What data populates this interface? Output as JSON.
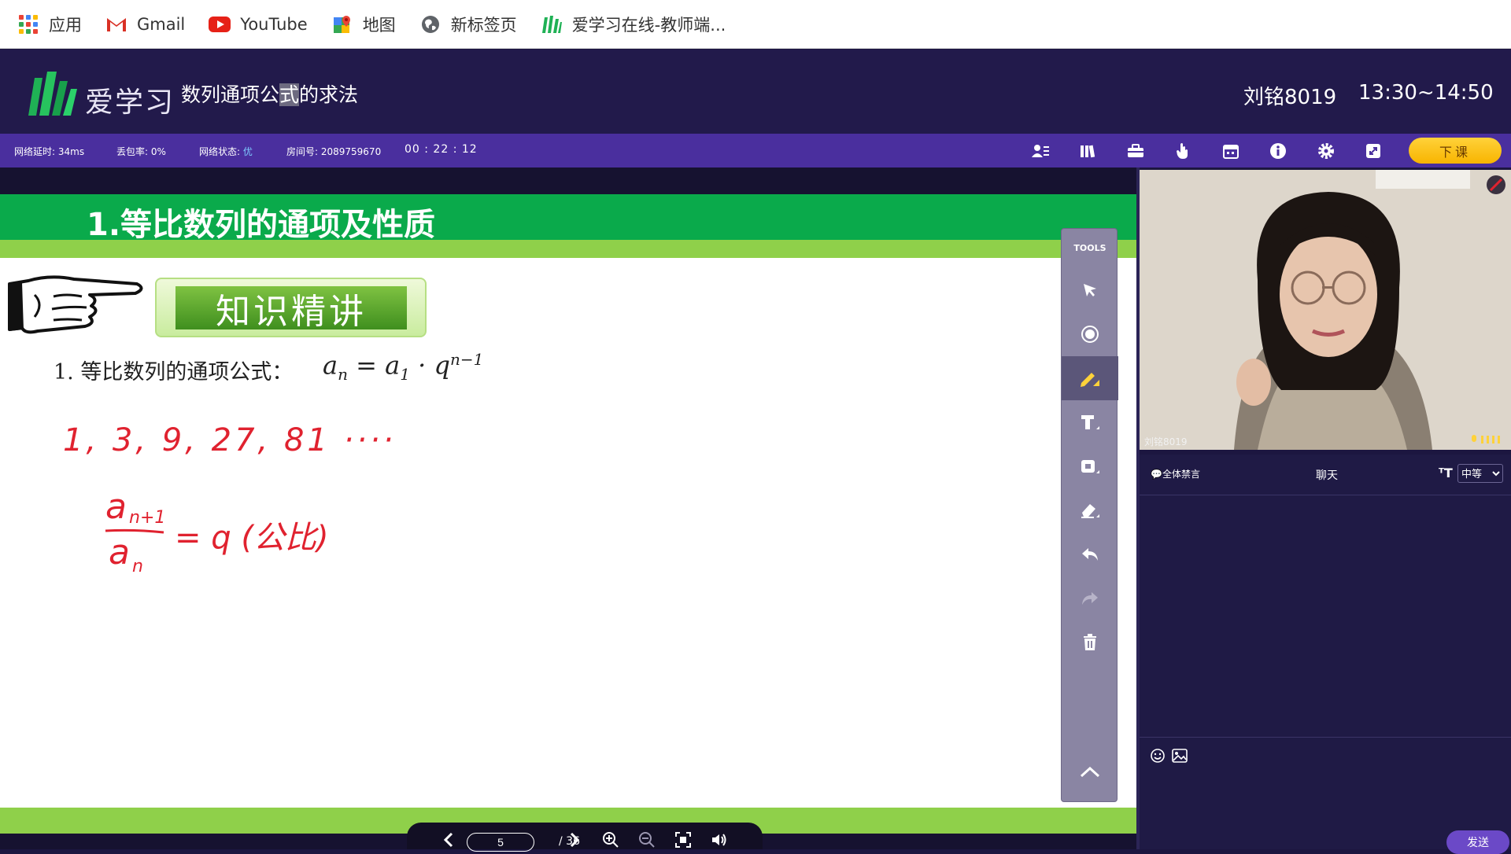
{
  "bookmarks": [
    {
      "label": "应用",
      "icon": "apps-grid-icon"
    },
    {
      "label": "Gmail",
      "icon": "gmail-icon"
    },
    {
      "label": "YouTube",
      "icon": "youtube-icon"
    },
    {
      "label": "地图",
      "icon": "maps-icon"
    },
    {
      "label": "新标签页",
      "icon": "globe-icon"
    },
    {
      "label": "爱学习在线-教师端...",
      "icon": "aixuexi-icon"
    }
  ],
  "header": {
    "logo_text": "爱学习",
    "course_title_a": "数列通项公",
    "course_title_hl": "式",
    "course_title_b": "的求法",
    "teacher": "刘铭8019",
    "time_range": "13:30~14:50"
  },
  "status": {
    "latency": "网络延时: 34ms",
    "loss": "丢包率: 0%",
    "net_label": "网络状态: ",
    "net_value": "优",
    "room": "房间号: 2089759670",
    "timer": "00 : 22 : 12",
    "end_label": "下课",
    "icons": [
      "user-list-icon",
      "library-icon",
      "toolbox-icon",
      "hand-raise-icon",
      "calendar-icon",
      "info-icon",
      "gear-icon",
      "fullscreen-icon"
    ]
  },
  "slide": {
    "heading": "1.等比数列的通项及性质",
    "badge": "知识精讲",
    "formula_text": "1.  等比数列的通项公式：",
    "formula_an": "a",
    "formula_n": "n",
    "formula_eq": " = a",
    "formula_1": "1",
    "formula_dot": " · q",
    "formula_exp": "n−1",
    "handwritten_sequence": "1, 3, 9, 27, 81 ····",
    "handwritten_ratio_num": "a",
    "handwritten_ratio_num_sub": "n+1",
    "handwritten_ratio_den": "a",
    "handwritten_ratio_den_sub": "n",
    "handwritten_ratio_rhs": "= q (公比)"
  },
  "tools": {
    "label": "TOOLS",
    "items": [
      "cursor-icon",
      "laser-pointer-icon",
      "pen-icon",
      "text-icon",
      "shape-icon",
      "eraser-icon",
      "undo-icon",
      "redo-icon",
      "trash-icon",
      "collapse-icon"
    ],
    "active": "pen-icon"
  },
  "pager": {
    "current": "5",
    "total": "/ 36"
  },
  "video": {
    "label": "刘铭8019"
  },
  "chat": {
    "mute_all": "全体禁言",
    "title": "聊天",
    "font_size_selected": "中等",
    "send_label": "发送"
  },
  "colors": {
    "header_bg": "#221a4b",
    "status_bg": "#4a2f9e",
    "slide_green": "#0aaa4b",
    "slide_lime": "#8fd04a",
    "end_button": "#f8b400",
    "handwriting": "#e0222f"
  }
}
